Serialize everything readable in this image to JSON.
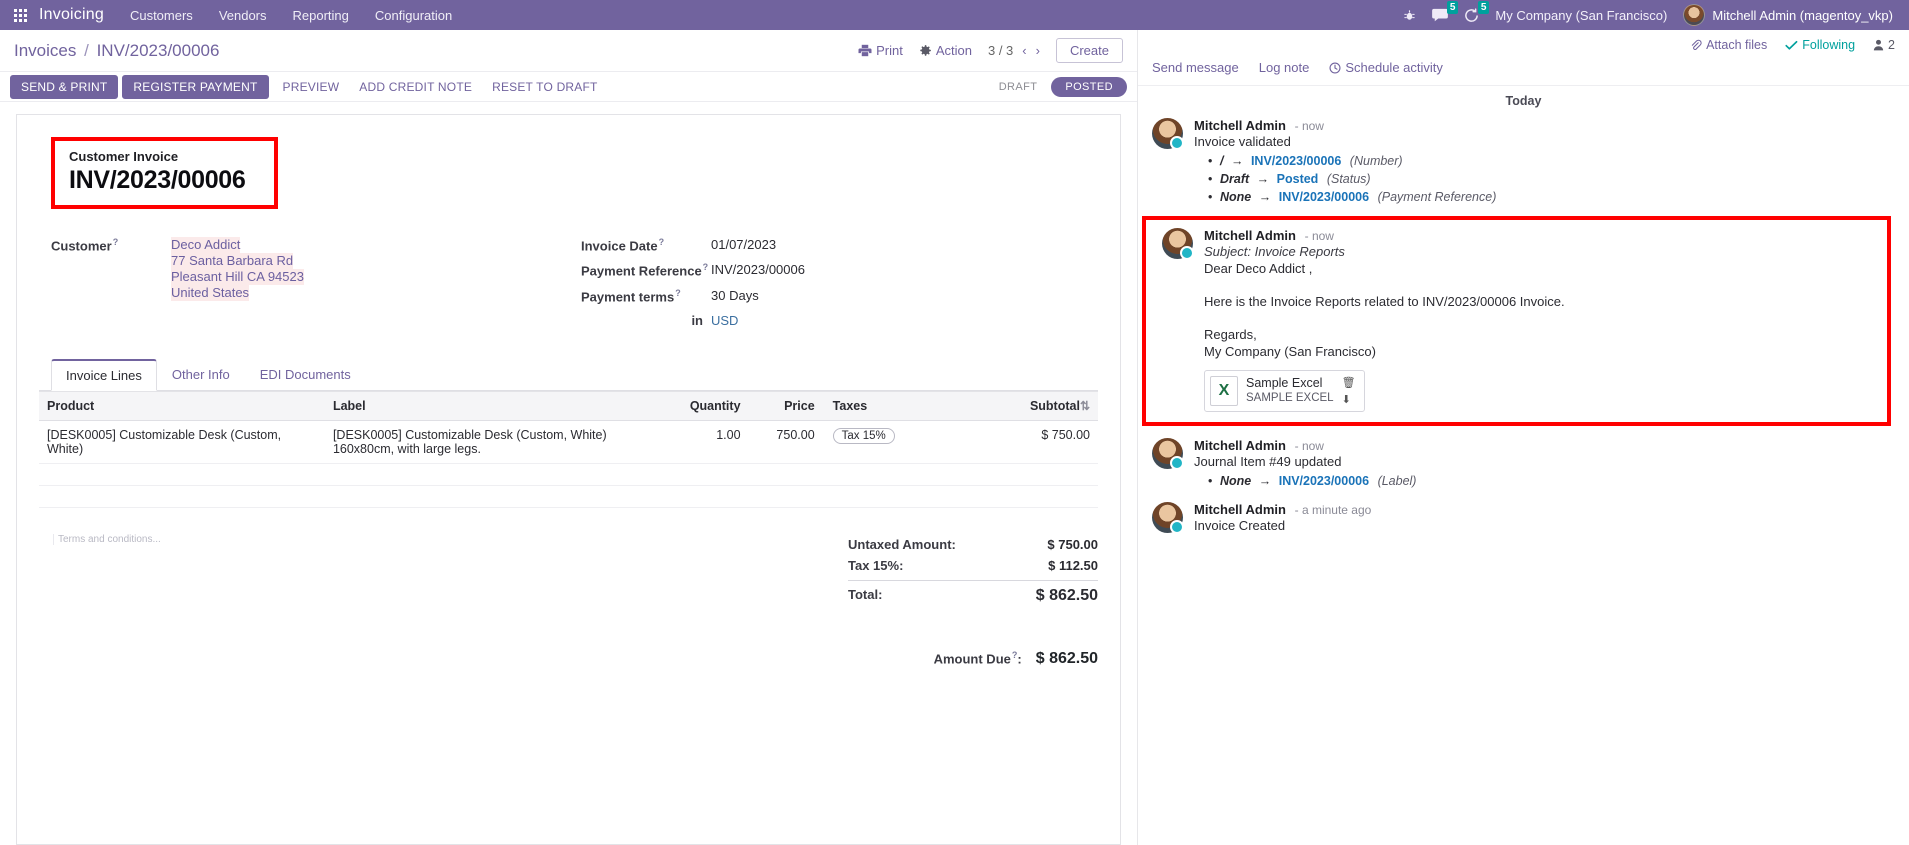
{
  "navbar": {
    "apps_icon": "apps-grid-icon",
    "brand": "Invoicing",
    "menus": [
      "Customers",
      "Vendors",
      "Reporting",
      "Configuration"
    ],
    "bug_icon": "debug-bug-icon",
    "messages_icon": "messages-icon",
    "messages_count": "5",
    "activities_icon": "activities-clock-icon",
    "activities_count": "5",
    "company": "My Company (San Francisco)",
    "user": "Mitchell Admin (magentoy_vkp)",
    "bg_color": "#71639e"
  },
  "control_panel": {
    "breadcrumb_root": "Invoices",
    "breadcrumb_sep": "/",
    "breadcrumb_current": "INV/2023/00006",
    "print_label": "Print",
    "action_label": "Action",
    "pager": "3 / 3",
    "prev_arrow": "‹",
    "next_arrow": "›",
    "create_label": "Create"
  },
  "statusbar": {
    "buttons": [
      {
        "label": "SEND & PRINT",
        "style": "primary"
      },
      {
        "label": "REGISTER PAYMENT",
        "style": "primary"
      },
      {
        "label": "PREVIEW",
        "style": "link"
      },
      {
        "label": "ADD CREDIT NOTE",
        "style": "link"
      },
      {
        "label": "RESET TO DRAFT",
        "style": "link"
      }
    ],
    "stages": [
      {
        "label": "DRAFT",
        "active": false
      },
      {
        "label": "POSTED",
        "active": true
      }
    ]
  },
  "form": {
    "doc_type_label": "Customer Invoice",
    "doc_number": "INV/2023/00006",
    "customer_label": "Customer",
    "customer_name": "Deco Addict",
    "customer_address": [
      "77 Santa Barbara Rd",
      "Pleasant Hill CA 94523",
      "United States"
    ],
    "invoice_date_label": "Invoice Date",
    "invoice_date_value": "01/07/2023",
    "payment_reference_label": "Payment Reference",
    "payment_reference_value": "INV/2023/00006",
    "payment_terms_label": "Payment terms",
    "payment_terms_value": "30 Days",
    "in_label": "in",
    "currency_value": "USD",
    "help_marker": "?"
  },
  "tabs": [
    {
      "label": "Invoice Lines",
      "active": true
    },
    {
      "label": "Other Info",
      "active": false
    },
    {
      "label": "EDI Documents",
      "active": false
    }
  ],
  "lines_table": {
    "columns": [
      "Product",
      "Label",
      "Quantity",
      "Price",
      "Taxes",
      "Subtotal"
    ],
    "sort_icon": "sort-icon",
    "rows": [
      {
        "product": "[DESK0005] Customizable Desk (Custom, White)",
        "label_line1": "[DESK0005] Customizable Desk (Custom, White)",
        "label_line2": "160x80cm, with large legs.",
        "quantity": "1.00",
        "price": "750.00",
        "taxes": "Tax 15%",
        "subtotal": "$ 750.00"
      }
    ]
  },
  "notes_placeholder": "Terms and conditions...",
  "totals": {
    "rows": [
      {
        "label": "Untaxed Amount:",
        "value": "$ 750.00"
      },
      {
        "label": "Tax 15%:",
        "value": "$ 112.50"
      }
    ],
    "total_label": "Total:",
    "total_value": "$ 862.50",
    "amount_due_label": "Amount Due",
    "amount_due_value": "$ 862.50"
  },
  "chatter": {
    "attach_files": "Attach files",
    "attach_icon": "paperclip-icon",
    "following": "Following",
    "following_icon": "check-icon",
    "followers_icon": "user-icon",
    "followers_count": "2",
    "send_message": "Send message",
    "log_note": "Log note",
    "schedule_activity": "Schedule activity",
    "schedule_icon": "clock-icon",
    "date_separator": "Today",
    "messages": [
      {
        "author": "Mitchell Admin",
        "time": "now",
        "body": "Invoice validated",
        "tracking": [
          {
            "old": "/",
            "new": "INV/2023/00006",
            "field": "(Number)"
          },
          {
            "old": "Draft",
            "new": "Posted",
            "field": "(Status)"
          },
          {
            "old": "None",
            "new": "INV/2023/00006",
            "field": "(Payment Reference)"
          }
        ],
        "highlighted": false
      },
      {
        "author": "Mitchell Admin",
        "time": "now",
        "subject": "Subject: Invoice Reports",
        "greeting": "Dear  Deco Addict ,",
        "body": "Here is the Invoice Reports related to  INV/2023/00006 Invoice.",
        "signoff": "Regards,",
        "signature": "My Company (San Francisco)",
        "attachment": {
          "name": "Sample Excel",
          "type": "SAMPLE EXCEL",
          "icon": "excel-file-icon",
          "delete_icon": "trash-icon",
          "download_icon": "download-icon"
        },
        "highlighted": true
      },
      {
        "author": "Mitchell Admin",
        "time": "now",
        "body": "Journal Item #49 updated",
        "tracking": [
          {
            "old": "None",
            "new": "INV/2023/00006",
            "field": "(Label)"
          }
        ],
        "highlighted": false
      },
      {
        "author": "Mitchell Admin",
        "time": "a minute ago",
        "body": "Invoice Created",
        "highlighted": false
      }
    ]
  }
}
